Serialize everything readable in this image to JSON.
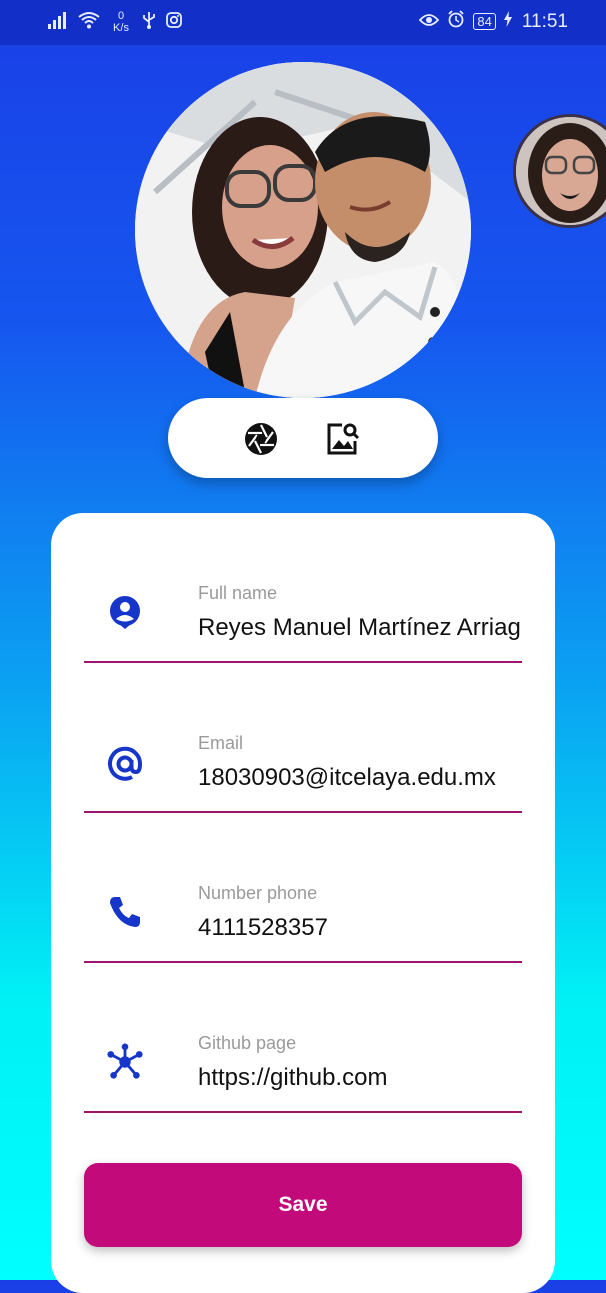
{
  "status_bar": {
    "net_speed_value": "0",
    "net_speed_unit": "K/s",
    "battery": "84",
    "time": "11:51"
  },
  "profile": {
    "main_photo_icon": "profile-photo",
    "secondary_photo_icon": "contact-photo"
  },
  "photo_actions": {
    "camera_icon": "camera-shutter-icon",
    "gallery_icon": "image-search-icon"
  },
  "form": {
    "full_name": {
      "label": "Full name",
      "value": "Reyes Manuel Martínez Arriag",
      "icon": "person-pin-icon"
    },
    "email": {
      "label": "Email",
      "value": "18030903@itcelaya.edu.mx",
      "icon": "at-sign-icon"
    },
    "phone": {
      "label": "Number phone",
      "value": "4111528357",
      "icon": "phone-icon"
    },
    "github": {
      "label": "Github page",
      "value": "https://github.com",
      "icon": "hub-icon"
    },
    "save_label": "Save"
  },
  "colors": {
    "accent": "#c20a7a",
    "icon_blue": "#1636c9",
    "gradient_top": "#1a3fe6",
    "gradient_bottom": "#00ffff"
  }
}
